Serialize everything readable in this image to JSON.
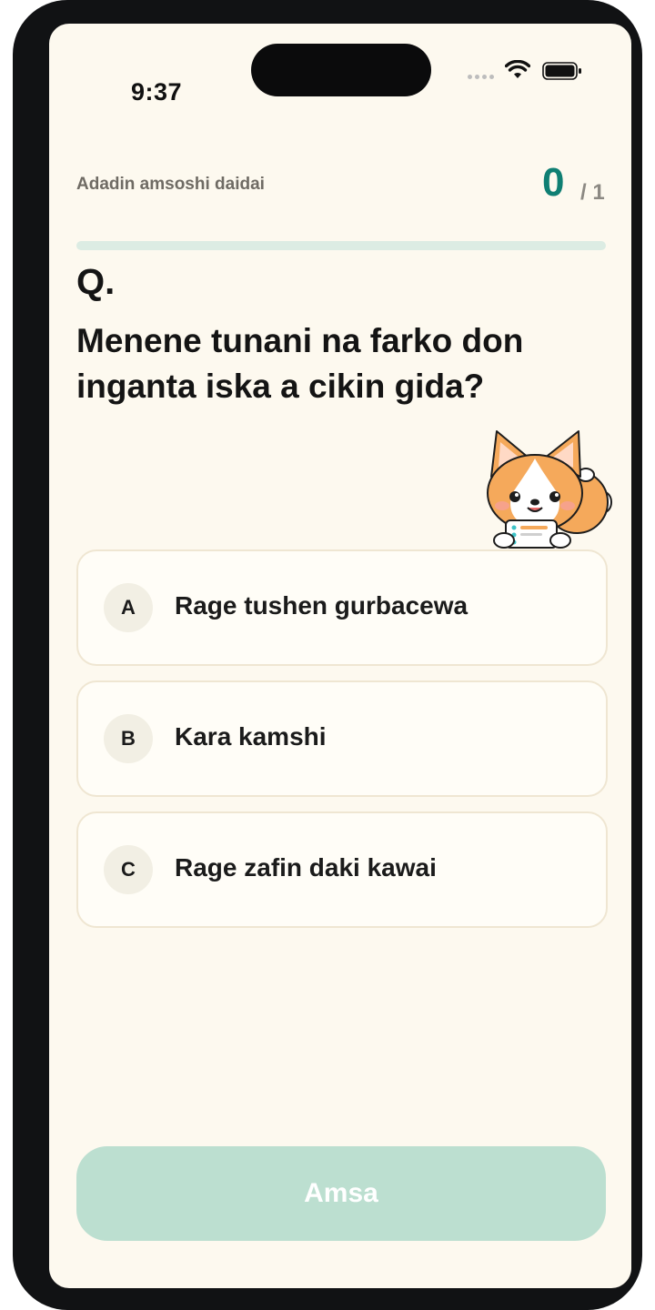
{
  "status_bar": {
    "time": "9:37"
  },
  "header": {
    "quiz_title": "Adadin amsoshi daidai",
    "score_current": "0",
    "score_total": "/ 1",
    "progress_fraction": 0
  },
  "question": {
    "prefix": "Q.",
    "text": "Menene tunani na farko don inganta iska a cikin gida?"
  },
  "options": [
    {
      "letter": "A",
      "label": "Rage tushen gurbacewa"
    },
    {
      "letter": "B",
      "label": "Kara kamshi"
    },
    {
      "letter": "C",
      "label": "Rage zafin daki kawai"
    }
  ],
  "submit": {
    "label": "Amsa"
  },
  "colors": {
    "accent": "#0f7f73",
    "background": "#fdf9ef",
    "button_disabled": "#bcdfd0"
  },
  "icons": {
    "mascot": "corgi-with-card-icon",
    "wifi": "wifi-icon",
    "battery": "battery-icon"
  }
}
